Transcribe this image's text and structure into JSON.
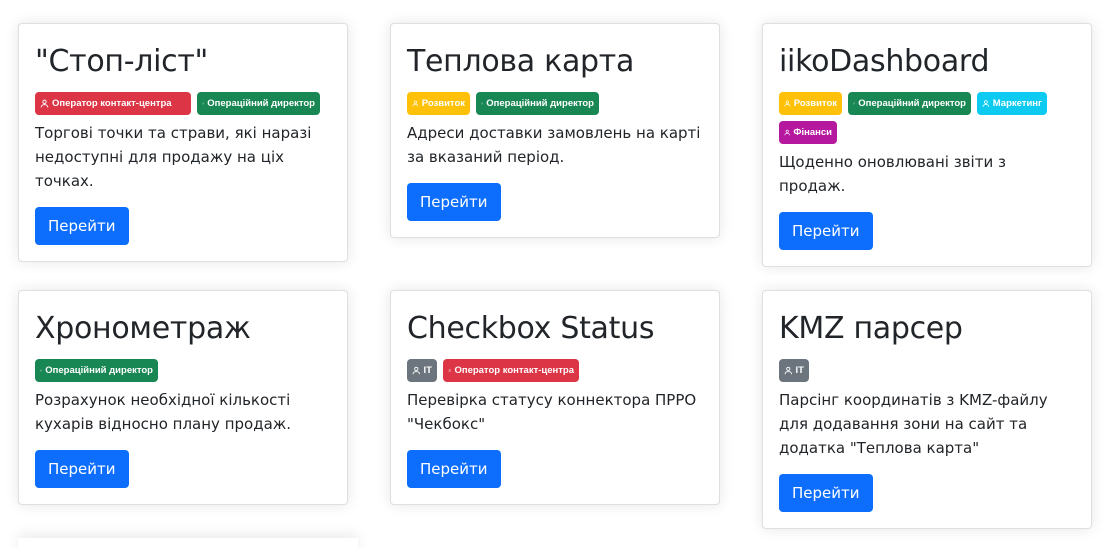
{
  "cards": [
    {
      "title": "\"Стоп-ліст\"",
      "badges": [
        "Оператор контакт-центра",
        "Операційний директор"
      ],
      "description": "Торгові точки та страви, які наразі недоступні для продажу на ціх точках.",
      "button": "Перейти"
    },
    {
      "title": "Теплова карта",
      "badges": [
        "Розвиток",
        "Операційний директор"
      ],
      "description": "Адреси доставки замовлень на карті за вказаний період.",
      "button": "Перейти"
    },
    {
      "title": "iikoDashboard",
      "badges": [
        "Розвиток",
        "Операційний директор",
        "Маркетинг",
        "Фінанси"
      ],
      "description": "Щоденно оновлювані звіти з продаж.",
      "button": "Перейти"
    },
    {
      "title": "Хронометраж",
      "badges": [
        "Операційний директор"
      ],
      "description": "Розрахунок необхідної кількості кухарів відносно плану продаж.",
      "button": "Перейти"
    },
    {
      "title": "Checkbox Status",
      "badges": [
        "IT",
        "Оператор контакт-центра"
      ],
      "description": "Перевірка статусу коннектора ПРРО \"Чекбокс\"",
      "button": "Перейти"
    },
    {
      "title": "KMZ парсер",
      "badges": [
        "IT"
      ],
      "description": "Парсінг координатів з KMZ-файлу для додавання зони на сайт та додатка \"Теплова карта\"",
      "button": "Перейти"
    }
  ],
  "badge_colors": {
    "Оператор контакт-центра": "#dc3545",
    "Операційний директор": "#198754",
    "Розвиток": "#ffc107",
    "Маркетинг": "#0dcaf0",
    "Фінанси": "#b5179e",
    "IT": "#6c757d"
  },
  "badge_icon": "person-icon",
  "accent_color": "#0d6efd"
}
